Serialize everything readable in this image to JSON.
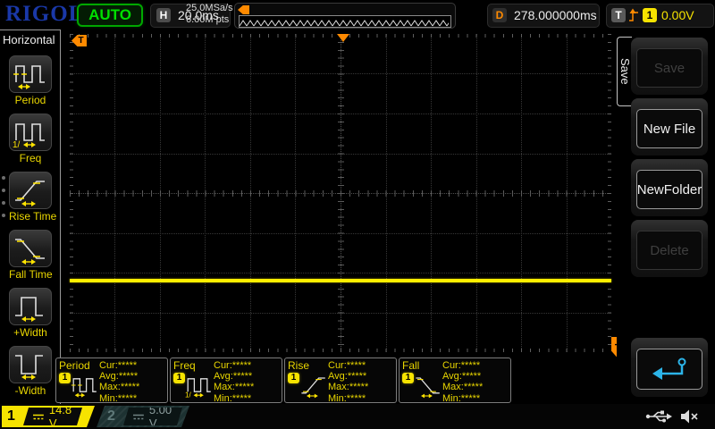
{
  "top_bar": {
    "logo": "RIGOL",
    "run_state": "AUTO",
    "horizontal": {
      "badge": "H",
      "scale": "20.0ms"
    },
    "acquisition": {
      "sample_rate": "25.0MSa/s",
      "mem_depth": "6.00M pts"
    },
    "delay": {
      "badge": "D",
      "value": "278.000000ms"
    },
    "trigger": {
      "badge": "T",
      "source": "1",
      "level": "0.00V"
    }
  },
  "left_menu": {
    "title": "Horizontal",
    "items": [
      {
        "label": "Period"
      },
      {
        "label": "Freq"
      },
      {
        "label": "Rise Time"
      },
      {
        "label": "Fall Time"
      },
      {
        "label": "+Width"
      },
      {
        "label": "-Width"
      }
    ]
  },
  "right_menu": {
    "tab_title": "Save",
    "buttons": [
      {
        "label": "Save",
        "enabled": false
      },
      {
        "label": "New File",
        "enabled": true
      },
      {
        "label": "NewFolder",
        "enabled": true
      },
      {
        "label": "Delete",
        "enabled": false
      }
    ]
  },
  "grid_markers": {
    "trigger_time_label": "T",
    "trigger_level_label": "T"
  },
  "measurements": {
    "stat_labels": {
      "cur": "Cur:",
      "avg": "Avg:",
      "max": "Max:",
      "min": "Min:"
    },
    "items": [
      {
        "name": "Period",
        "source": "1",
        "cur": "*****",
        "avg": "*****",
        "max": "*****",
        "min": "*****"
      },
      {
        "name": "Freq",
        "source": "1",
        "cur": "*****",
        "avg": "*****",
        "max": "*****",
        "min": "*****"
      },
      {
        "name": "Rise",
        "source": "1",
        "cur": "*****",
        "avg": "*****",
        "max": "*****",
        "min": "*****"
      },
      {
        "name": "Fall",
        "source": "1",
        "cur": "*****",
        "avg": "*****",
        "max": "*****",
        "min": "*****"
      }
    ]
  },
  "channels": [
    {
      "number": "1",
      "scale": "14.8 V",
      "active": true
    },
    {
      "number": "2",
      "scale": "5.00 V",
      "active": false
    }
  ],
  "icons": [
    "period-icon",
    "freq-icon",
    "rise-time-icon",
    "fall-time-icon",
    "plus-width-icon",
    "minus-width-icon",
    "trigger-slope-icon",
    "dc-coupling-icon",
    "return-arrow-icon",
    "usb-icon",
    "speaker-muted-icon"
  ],
  "colors": {
    "ch1_yellow": "#f6e300",
    "ch2_teal": "#7e9898",
    "trigger_orange": "#ff8a00",
    "run_green": "#00dc00",
    "logo_blue": "#1a38a8",
    "return_cyan": "#2cb4e8",
    "trace_yellow": "#ffee00"
  }
}
